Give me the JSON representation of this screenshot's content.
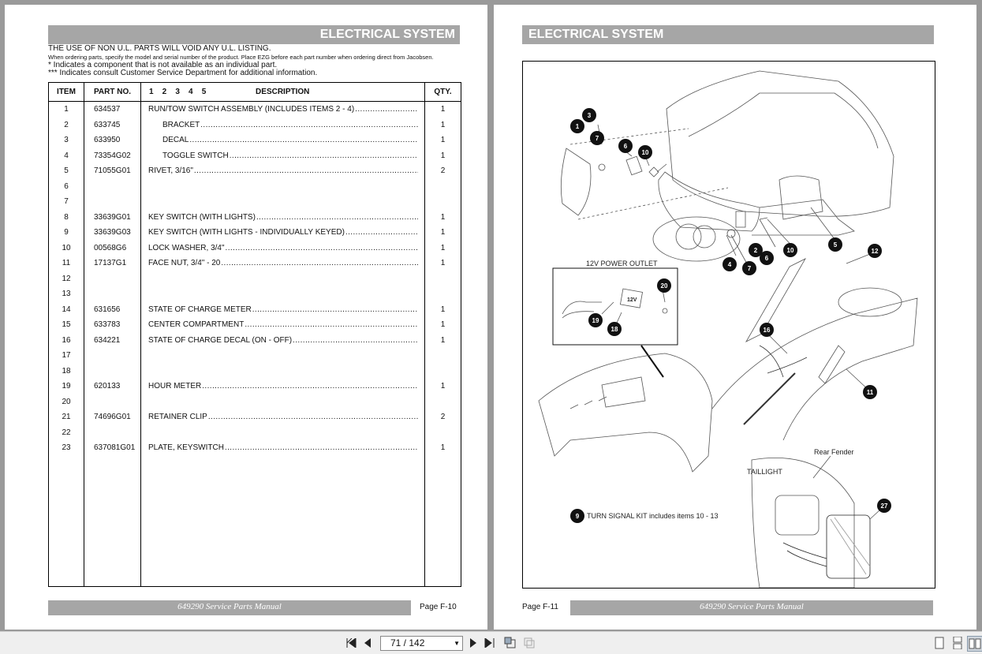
{
  "left_page": {
    "title": "ELECTRICAL SYSTEM",
    "notes": {
      "line1": "THE USE OF NON U.L. PARTS WILL VOID ANY U.L. LISTING.",
      "line2": "When ordering parts, specify the model and serial number of the product. Place EZG before each part number when ordering direct from Jacobsen.",
      "line3": "* Indicates a component that is not available as an individual part.",
      "line4": "*** Indicates consult Customer Service Department for additional information."
    },
    "table_headers": {
      "item": "ITEM",
      "part": "PART NO.",
      "levels": "1    2    3    4    5",
      "description": "DESCRIPTION",
      "qty": "QTY."
    },
    "rows": [
      {
        "item": "1",
        "part": "634537",
        "desc": "RUN/TOW SWITCH ASSEMBLY (INCLUDES ITEMS 2 - 4)",
        "qty": "1",
        "indent": false
      },
      {
        "item": "2",
        "part": "633745",
        "desc": "BRACKET",
        "qty": "1",
        "indent": true
      },
      {
        "item": "3",
        "part": "633950",
        "desc": "DECAL",
        "qty": "1",
        "indent": true
      },
      {
        "item": "4",
        "part": "73354G02",
        "desc": "TOGGLE SWITCH",
        "qty": "1",
        "indent": true
      },
      {
        "item": "5",
        "part": "71055G01",
        "desc": "RIVET, 3/16\"",
        "qty": "2",
        "indent": false
      },
      {
        "item": "6",
        "part": "",
        "desc": "",
        "qty": "",
        "indent": false
      },
      {
        "item": "7",
        "part": "",
        "desc": "",
        "qty": "",
        "indent": false
      },
      {
        "item": "8",
        "part": "33639G01",
        "desc": "KEY SWITCH (WITH LIGHTS)",
        "qty": "1",
        "indent": false
      },
      {
        "item": "9",
        "part": "33639G03",
        "desc": "KEY SWITCH (WITH LIGHTS - INDIVIDUALLY KEYED)",
        "qty": "1",
        "indent": false
      },
      {
        "item": "10",
        "part": "00568G6",
        "desc": "LOCK WASHER, 3/4\"",
        "qty": "1",
        "indent": false
      },
      {
        "item": "11",
        "part": "17137G1",
        "desc": "FACE NUT, 3/4\" - 20",
        "qty": "1",
        "indent": false
      },
      {
        "item": "12",
        "part": "",
        "desc": "",
        "qty": "",
        "indent": false
      },
      {
        "item": "13",
        "part": "",
        "desc": "",
        "qty": "",
        "indent": false
      },
      {
        "item": "14",
        "part": "631656",
        "desc": "STATE OF CHARGE METER",
        "qty": "1",
        "indent": false
      },
      {
        "item": "15",
        "part": "633783",
        "desc": "CENTER COMPARTMENT",
        "qty": "1",
        "indent": false
      },
      {
        "item": "16",
        "part": "634221",
        "desc": "STATE OF CHARGE DECAL (ON - OFF)",
        "qty": "1",
        "indent": false
      },
      {
        "item": "17",
        "part": "",
        "desc": "",
        "qty": "",
        "indent": false
      },
      {
        "item": "18",
        "part": "",
        "desc": "",
        "qty": "",
        "indent": false
      },
      {
        "item": "19",
        "part": "620133",
        "desc": "HOUR METER",
        "qty": "1",
        "indent": false
      },
      {
        "item": "20",
        "part": "",
        "desc": "",
        "qty": "",
        "indent": false
      },
      {
        "item": "21",
        "part": "74696G01",
        "desc": "RETAINER CLIP",
        "qty": "2",
        "indent": false
      },
      {
        "item": "22",
        "part": "",
        "desc": "",
        "qty": "",
        "indent": false
      },
      {
        "item": "23",
        "part": "637081G01",
        "desc": "PLATE, KEYSWITCH",
        "qty": "1",
        "indent": false
      }
    ],
    "footer": "649290 Service Parts Manual",
    "page_label": "Page  F-10"
  },
  "right_page": {
    "title": "ELECTRICAL SYSTEM",
    "labels": {
      "power_outlet": "12V POWER OUTLET",
      "outlet_badge": "12V",
      "rear_fender": "Rear Fender",
      "taillight": "TAILLIGHT",
      "turn_signal_num": "9",
      "turn_signal": "TURN SIGNAL KIT includes items 10 - 13"
    },
    "callouts": [
      "1",
      "3",
      "7",
      "6",
      "10",
      "2",
      "4",
      "7",
      "6",
      "10",
      "5",
      "12",
      "20",
      "19",
      "18",
      "16",
      "11",
      "27"
    ],
    "footer": "649290 Service Parts Manual",
    "page_label": "Page  F-11"
  },
  "toolbar": {
    "page_value": "71 / 142",
    "icons": [
      "first-page-icon",
      "prev-page-icon",
      "next-page-icon",
      "last-page-icon",
      "rotate-icon",
      "copy-icon",
      "single-page-view-icon",
      "continuous-view-icon",
      "facing-pages-view-icon"
    ]
  }
}
